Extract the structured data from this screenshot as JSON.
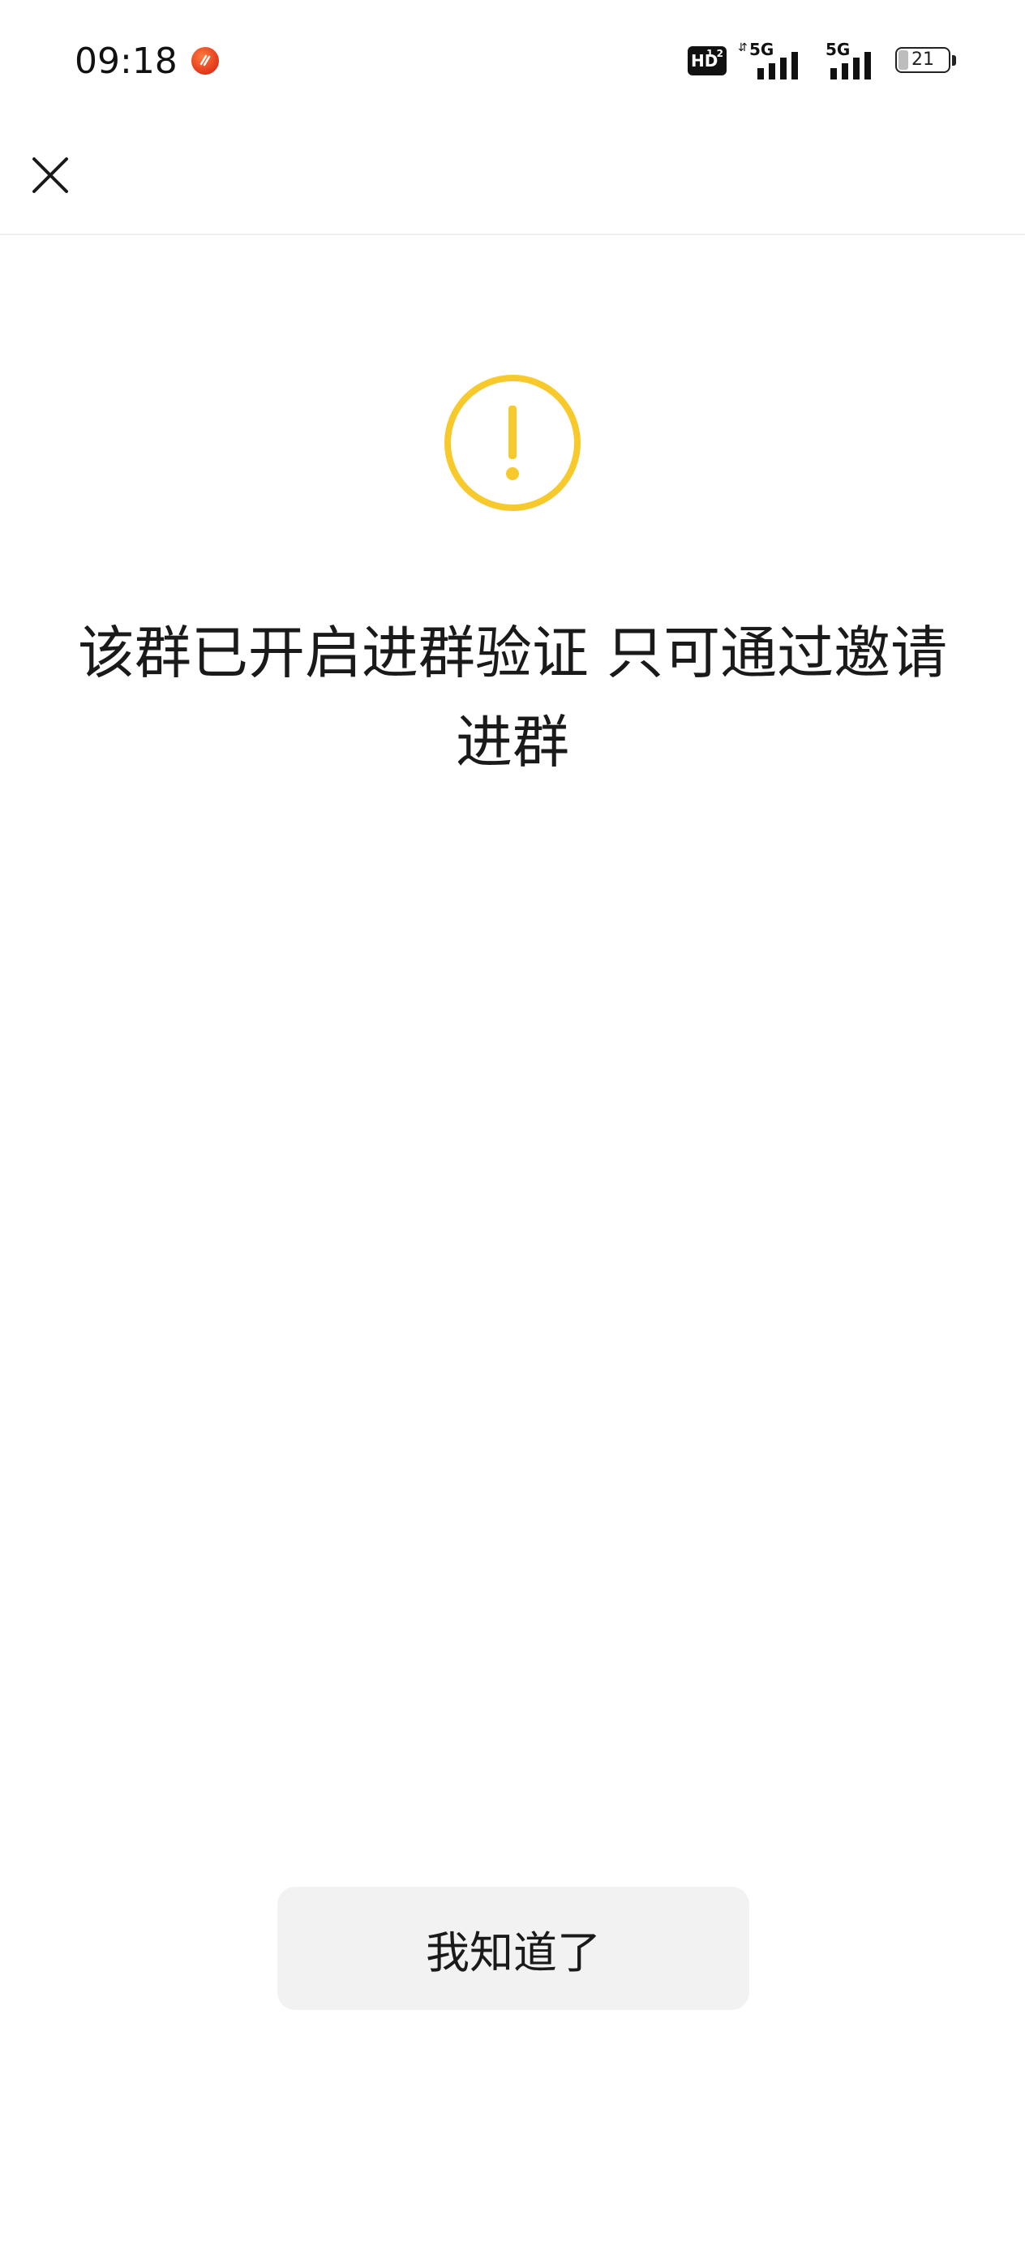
{
  "status_bar": {
    "time": "09:18",
    "app_icon": "notification-app-icon",
    "hd_label": "HD",
    "hd_sub": "1 2",
    "signal_1": {
      "network": "5G"
    },
    "signal_2": {
      "network": "5G"
    },
    "battery_level": "21"
  },
  "top_bar": {
    "close_icon": "close-icon"
  },
  "dialog": {
    "icon": "warning-icon",
    "icon_color": "#F7C92B",
    "message": "该群已开启进群验证 只可通过邀请进群",
    "confirm_label": "我知道了"
  }
}
